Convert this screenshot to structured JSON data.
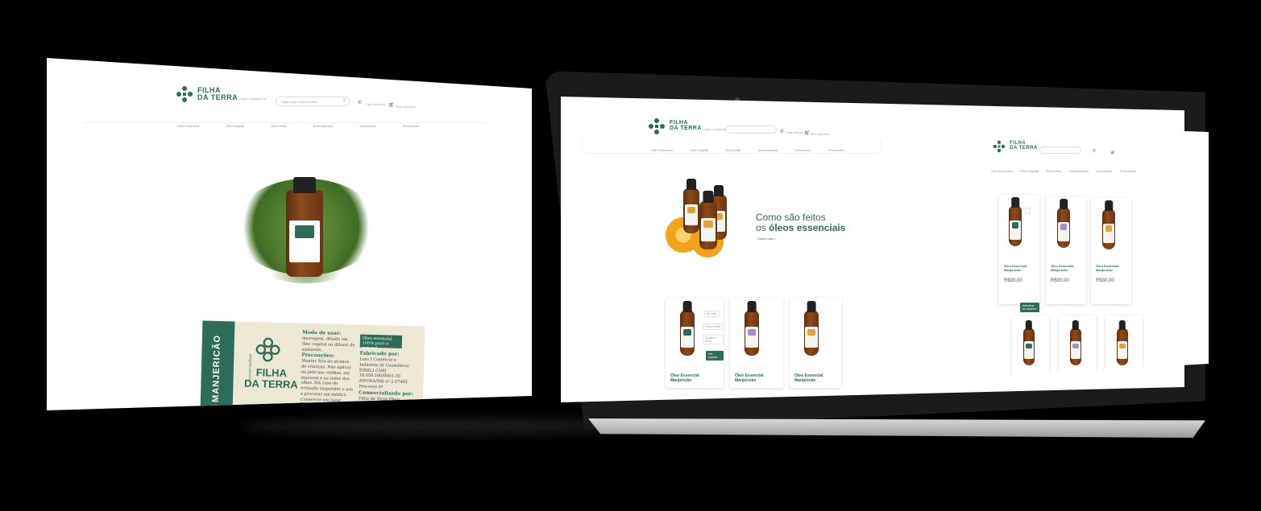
{
  "left_screen": {
    "brand_line1": "FILHA",
    "brand_line2": "DA TERRA",
    "login": "Login | Cadastre-se",
    "search_placeholder": "Digite aqui o que procura",
    "whatsapp": "Fale conosco",
    "cart": "Meu carrinho",
    "nav": [
      "Óleo Essencial",
      "Óleo Vegetal",
      "Bem-estar",
      "Aromaterapia",
      "Acessórios",
      "Promoções"
    ],
    "label": {
      "product_name": "MANJERICÃO",
      "latin_name": "Ocimum basilicum",
      "modo_title": "Modo de usar:",
      "modo_text": "massagem, diluído em óleo vegetal ou difusor de ambiente.",
      "prec_title": "Precauções:",
      "prec_text": "Manter fora do alcance de crianças. Não aplicar na pele nas virilhas, em mucosas e ao redor dos olhos. Em caso de irritação suspender o uso e procurar um médico. Conservar em lugar fresco e ao abrigo da luz. Uso externo.",
      "tag_line1": "Óleo essencial",
      "tag_line2": "100% puro e natural",
      "fab_title": "Fabricado por:",
      "fab_text": "Luss I Comércio e Indústria de Cosméticos EIRELI CNPJ 18.059.160/0001-30 ANVISA/MS nº 2.07465 Processo nº",
      "com_title": "Comercializado por:",
      "com_text": "Filha da Terra Óleos Naturais"
    }
  },
  "laptop_screen": {
    "brand_line1": "FILHA",
    "brand_line2": "DA TERRA",
    "login": "Login | Cadastre-se",
    "whatsapp": "Fale conosco",
    "cart": "Meu carrinho",
    "nav": [
      "Óleo Essencial",
      "Óleo Vegetal",
      "Bem-estar",
      "Aromaterapia",
      "Acessórios",
      "Promoções"
    ],
    "hero_line1": "Como são feitos",
    "hero_line2_prefix": "os ",
    "hero_line2_bold": "óleos essenciais",
    "hero_link": "Saiba mais »",
    "options": [
      "Kit 10ml",
      "Frasco 30ml",
      "Tamanho 50ml"
    ],
    "buy_button": "Ver opções",
    "products": [
      {
        "name": "Óleo Essencial",
        "sub": "Manjericão",
        "label_color": "#2e6b58"
      },
      {
        "name": "Óleo Essencial",
        "sub": "Manjericão",
        "label_color": "#a58fc0"
      },
      {
        "name": "Óleo Essencial",
        "sub": "Manjericão",
        "label_color": "#e0a43a"
      }
    ]
  },
  "right_screen": {
    "brand_line1": "FILHA",
    "brand_line2": "DA TERRA",
    "nav": [
      "Óleo Essencial",
      "Óleo Vegetal",
      "Bem-estar",
      "Aromaterapia",
      "Acessórios",
      "Promoções"
    ],
    "products": [
      {
        "name": "Óleo Essencial",
        "sub": "Manjericão",
        "price": "R$30,00",
        "label_color": "#2e6b58"
      },
      {
        "name": "Óleo Essencial",
        "sub": "Manjericão",
        "price": "R$30,00",
        "label_color": "#a58fc0"
      },
      {
        "name": "Óleo Essencial",
        "sub": "Manjericão",
        "price": "R$30,00",
        "label_color": "#e0a43a"
      }
    ],
    "add_button": "Adicionar ao carrinho"
  },
  "colors": {
    "brand_green": "#2e6b58",
    "bottle_amber": "#7a3d14",
    "orange": "#f3a21b"
  }
}
